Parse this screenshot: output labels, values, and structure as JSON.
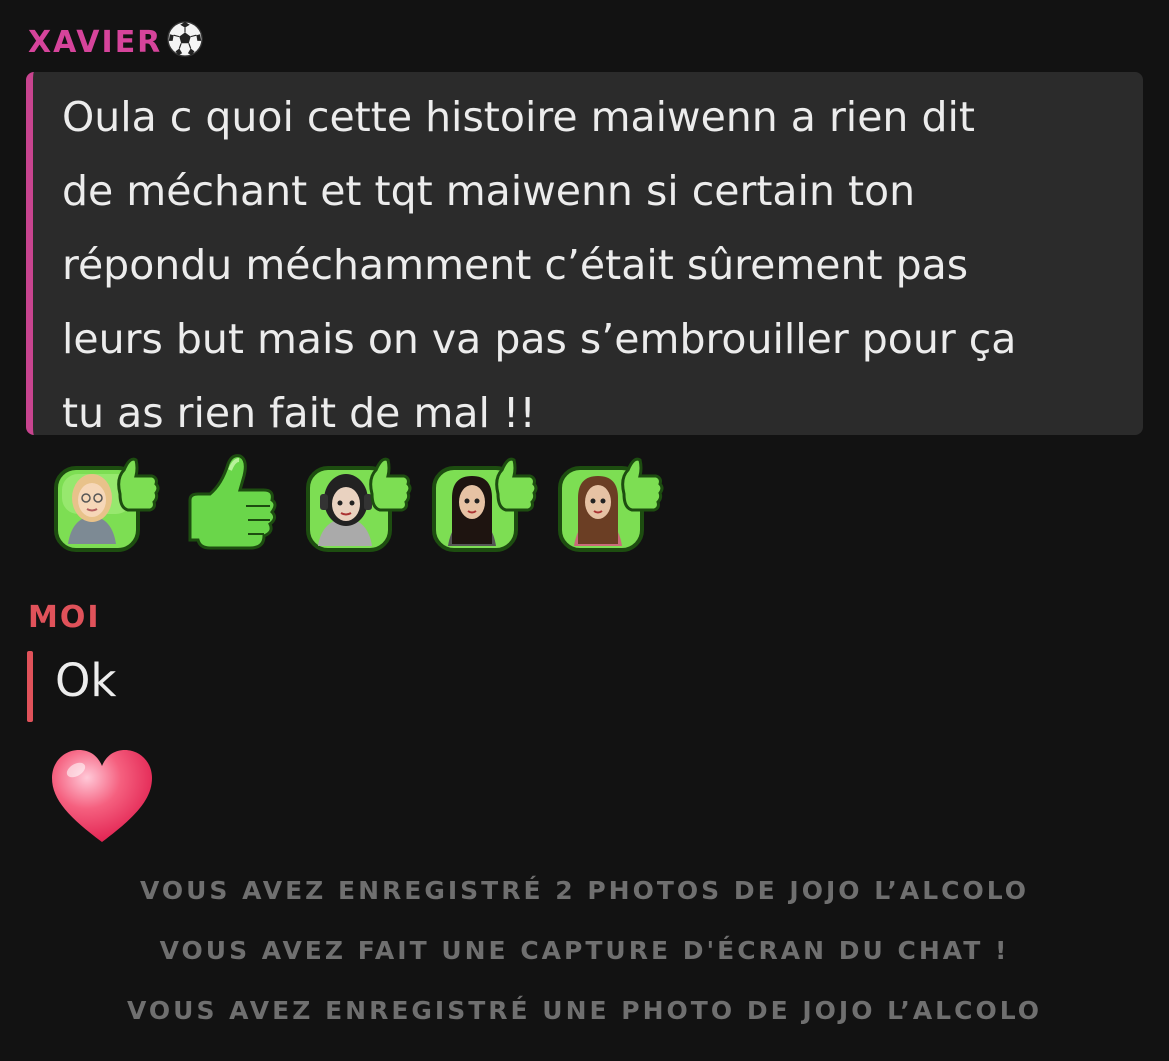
{
  "messages": [
    {
      "sender": "XAVIER",
      "sender_emoji": "soccer-ball-icon",
      "sender_color": "#d6449b",
      "text": "Oula c quoi cette histoire maiwenn a rien dit\nde méchant et tqt maiwenn si certain ton\nrépondu méchamment c’était sûrement pas\nleurs but mais on va pas s’embrouiller pour ça\ntu as rien fait de mal !!",
      "reactions": [
        "bitmoji-thumbs-up-blonde",
        "thumbs-up-emoji",
        "bitmoji-thumbs-up-headphones",
        "bitmoji-thumbs-up-dark-hair",
        "bitmoji-thumbs-up-brown-hair"
      ]
    },
    {
      "sender": "MOI",
      "sender_color": "#e0525a",
      "text": "Ok",
      "reactions": [
        "heart-emoji"
      ]
    }
  ],
  "system_messages": [
    "VOUS AVEZ ENREGISTRÉ 2 PHOTOS DE JOJO L’ALCOLO",
    "VOUS AVEZ FAIT UNE CAPTURE D'ÉCRAN DU CHAT !",
    "VOUS AVEZ ENREGISTRÉ UNE PHOTO DE JOJO L’ALCOLO"
  ],
  "colors": {
    "background": "#121212",
    "bubble": "#2b2b2b",
    "accent_xavier": "#d6449b",
    "accent_moi": "#e0525a",
    "system_text": "#6f6f6f"
  }
}
